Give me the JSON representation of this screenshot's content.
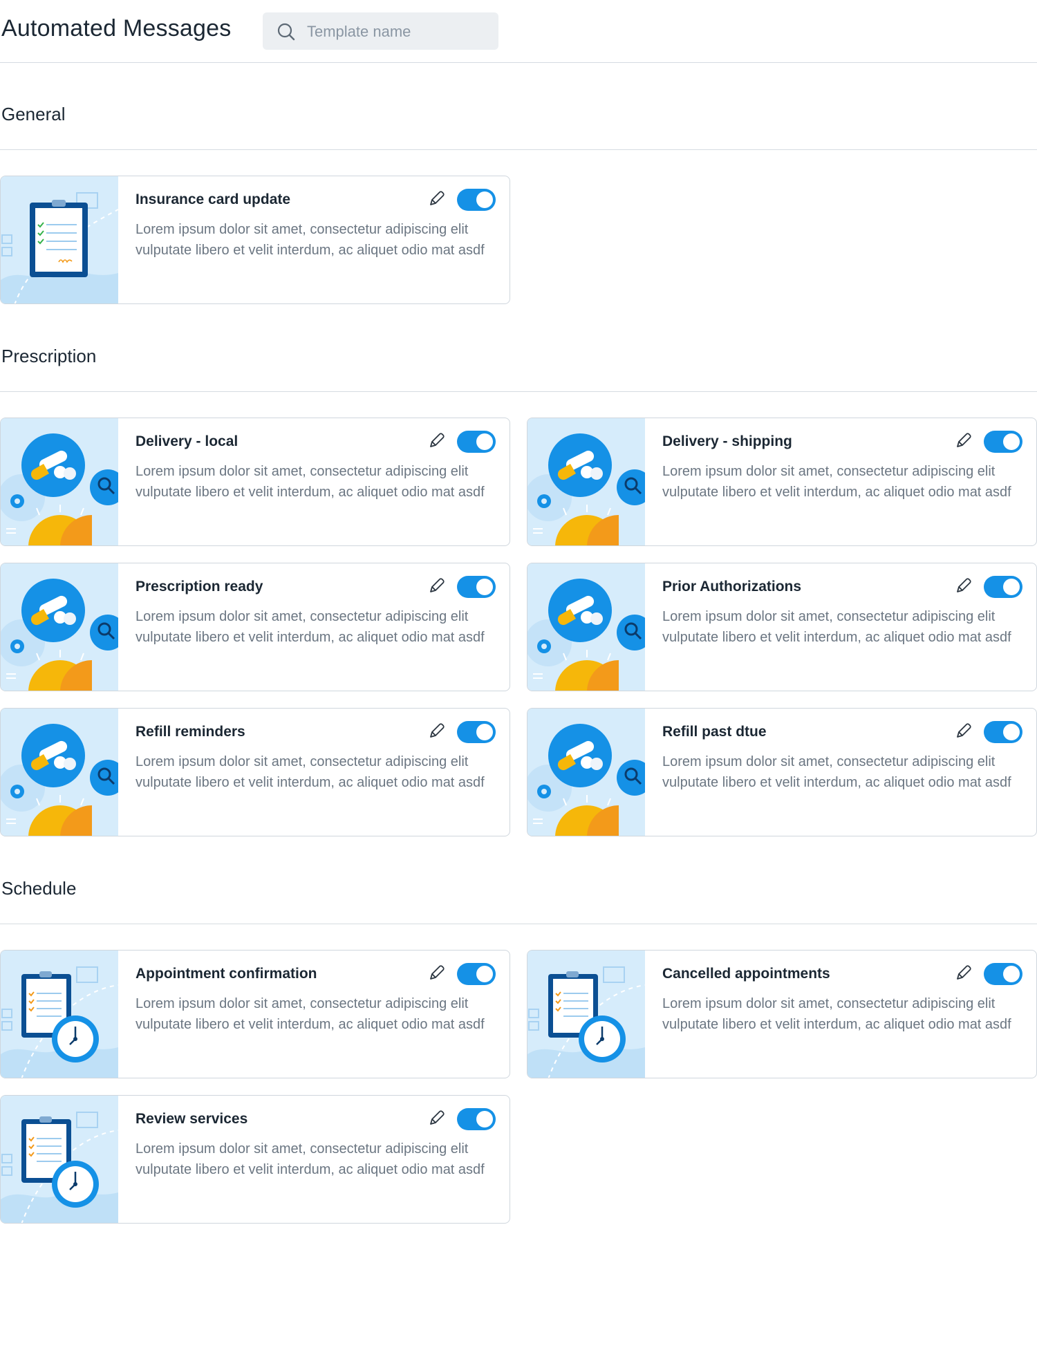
{
  "header": {
    "title": "Automated Messages",
    "search_placeholder": "Template name"
  },
  "icons": {
    "search": "search-icon",
    "edit": "pencil-icon",
    "toggle": "toggle-switch"
  },
  "colors": {
    "accent": "#1591e6",
    "art_background": "#d6ecfb",
    "sun": "#f6b70a"
  },
  "lorem": "Lorem ipsum dolor sit amet, consectetur adipiscing elit vulputate libero et velit interdum, ac aliquet odio mat asdf",
  "sections": [
    {
      "title": "General",
      "cards": [
        {
          "title": "Insurance card update",
          "desc": "Lorem ipsum dolor sit amet, consectetur adipiscing elit vulputate libero et velit interdum, ac aliquet odio mat asdf",
          "art": "clipboard-illustration",
          "enabled": true
        }
      ]
    },
    {
      "title": "Prescription",
      "cards": [
        {
          "title": "Delivery - local",
          "desc": "Lorem ipsum dolor sit amet, consectetur adipiscing elit vulputate libero et velit interdum, ac aliquet odio mat asdf",
          "art": "pills-illustration",
          "enabled": true
        },
        {
          "title": "Delivery - shipping",
          "desc": "Lorem ipsum dolor sit amet, consectetur adipiscing elit vulputate libero et velit interdum, ac aliquet odio mat asdf",
          "art": "pills-illustration",
          "enabled": true
        },
        {
          "title": "Prescription ready",
          "desc": "Lorem ipsum dolor sit amet, consectetur adipiscing elit vulputate libero et velit interdum, ac aliquet odio mat asdf",
          "art": "pills-illustration",
          "enabled": true
        },
        {
          "title": "Prior Authorizations",
          "desc": "Lorem ipsum dolor sit amet, consectetur adipiscing elit vulputate libero et velit interdum, ac aliquet odio mat asdf",
          "art": "pills-illustration",
          "enabled": true
        },
        {
          "title": "Refill reminders",
          "desc": "Lorem ipsum dolor sit amet, consectetur adipiscing elit vulputate libero et velit interdum, ac aliquet odio mat asdf",
          "art": "pills-illustration",
          "enabled": true
        },
        {
          "title": "Refill past dtue",
          "desc": "Lorem ipsum dolor sit amet, consectetur adipiscing elit vulputate libero et velit interdum, ac aliquet odio mat asdf",
          "art": "pills-illustration",
          "enabled": true
        }
      ]
    },
    {
      "title": "Schedule",
      "cards": [
        {
          "title": "Appointment confirmation",
          "desc": "Lorem ipsum dolor sit amet, consectetur adipiscing elit vulputate libero et velit interdum, ac aliquet odio mat asdf",
          "art": "clipboard-clock-illustration",
          "enabled": true
        },
        {
          "title": "Cancelled appointments",
          "desc": "Lorem ipsum dolor sit amet, consectetur adipiscing elit vulputate libero et velit interdum, ac aliquet odio mat asdf",
          "art": "clipboard-clock-illustration",
          "enabled": true
        },
        {
          "title": "Review services",
          "desc": "Lorem ipsum dolor sit amet, consectetur adipiscing elit vulputate libero et velit interdum, ac aliquet odio mat asdf",
          "art": "clipboard-clock-illustration",
          "enabled": true
        }
      ]
    }
  ]
}
